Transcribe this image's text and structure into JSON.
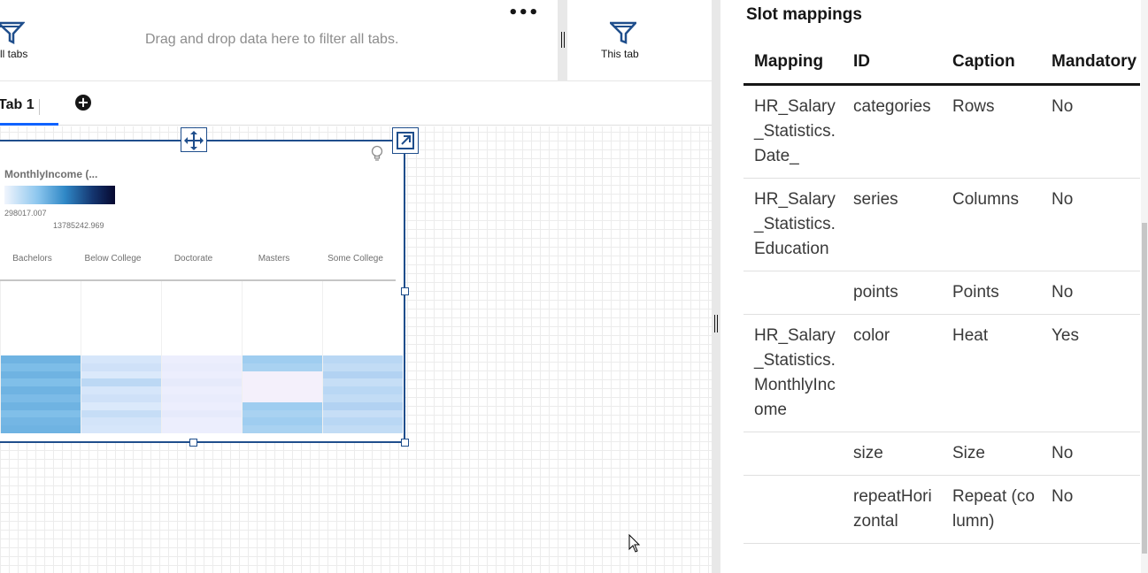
{
  "filter_bar": {
    "all_tabs_label": "ll tabs",
    "drop_hint": "Drag and drop data here to filter all tabs.",
    "more_label": "•••",
    "this_tab_label": "This tab"
  },
  "tabs": {
    "active_label": "Tab 1",
    "add_label": "+"
  },
  "widget": {
    "legend_title": "MonthlyIncome (...",
    "legend_min": "298017.007",
    "legend_max": "13785242.969",
    "columns": [
      "Bachelors",
      "Below College",
      "Doctorate",
      "Masters",
      "Some College"
    ]
  },
  "chart_data": {
    "type": "heatmap",
    "title": "",
    "color_measure": "MonthlyIncome (...",
    "color_range": [
      298017.007,
      13785242.969
    ],
    "columns": [
      "Bachelors",
      "Below College",
      "Doctorate",
      "Masters",
      "Some College"
    ],
    "colors": {
      "low": "#f1f5fd",
      "mid": "#2f87c6",
      "high": "#06082f"
    }
  },
  "panel": {
    "title": "Slot mappings",
    "headers": [
      "Mapping",
      "ID",
      "Caption",
      "Mandatory"
    ],
    "rows": [
      {
        "mapping": "HR_Salary_Statistics.Date_",
        "id": "categories",
        "caption": "Rows",
        "mandatory": "No"
      },
      {
        "mapping": "HR_Salary_Statistics.Education",
        "id": "series",
        "caption": "Columns",
        "mandatory": "No"
      },
      {
        "mapping": "",
        "id": "points",
        "caption": "Points",
        "mandatory": "No"
      },
      {
        "mapping": "HR_Salary_Statistics.MonthlyIncome",
        "id": "color",
        "caption": "Heat",
        "mandatory": "Yes"
      },
      {
        "mapping": "",
        "id": "size",
        "caption": "Size",
        "mandatory": "No"
      },
      {
        "mapping": "",
        "id": "repeatHorizontal",
        "caption": "Repeat (column)",
        "mandatory": "No"
      }
    ]
  }
}
